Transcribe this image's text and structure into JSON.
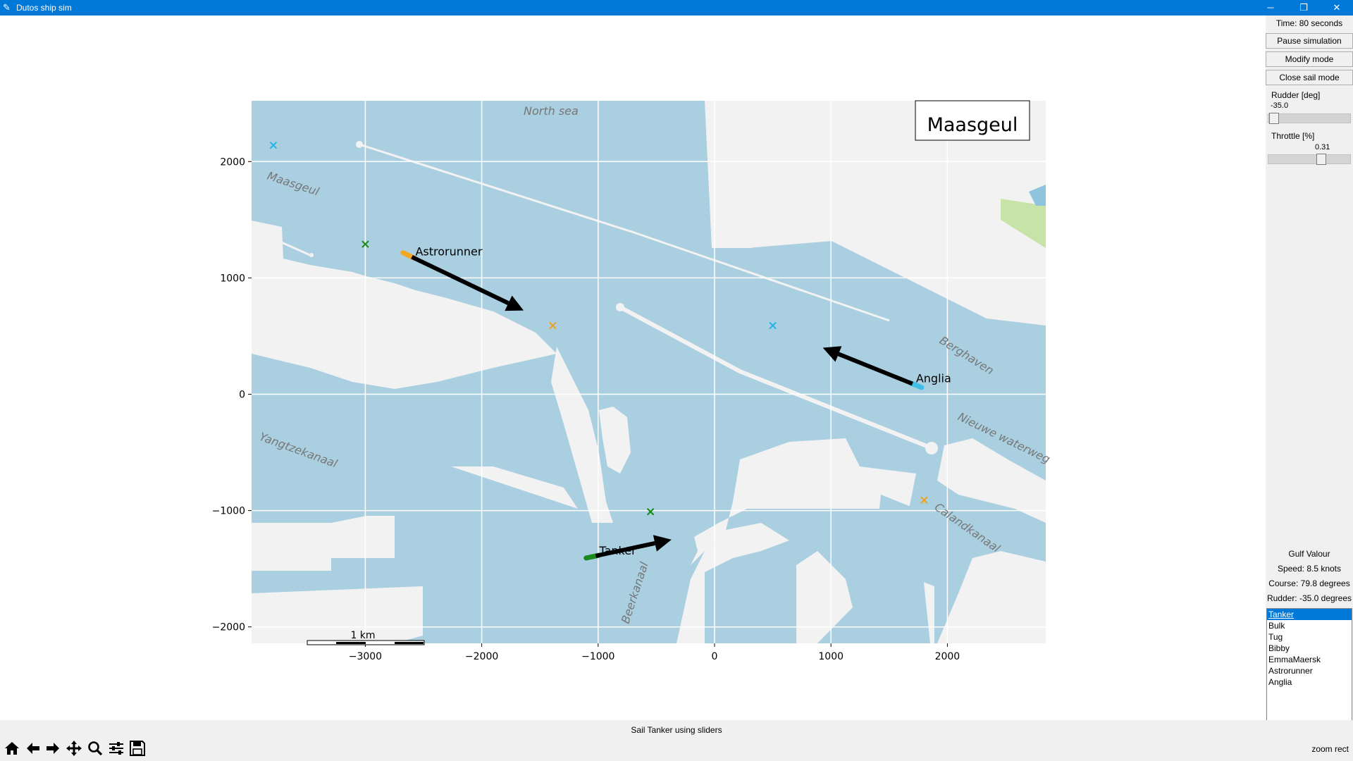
{
  "window": {
    "title": "Dutos ship sim",
    "minimize": "─",
    "restore": "❐",
    "close": "✕"
  },
  "sidebar": {
    "time": "Time: 80 seconds",
    "pause_label": "Pause simulation",
    "modify_label": "Modify mode",
    "close_sail_label": "Close sail mode",
    "rudder_label": "Rudder [deg]",
    "rudder_value": "-35.0",
    "rudder_position": 0.0,
    "throttle_label": "Throttle [%]",
    "throttle_value": "0.31",
    "throttle_position": 0.655,
    "ship_name": "Gulf Valour",
    "speed": "Speed: 8.5 knots",
    "course": "Course: 79.8 degrees",
    "rudder": "Rudder: -35.0 degrees",
    "ships": [
      "Tanker",
      "Bulk",
      "Tug",
      "Bibby",
      "EmmaMaersk",
      "Astrorunner",
      "Anglia"
    ],
    "selected_ship": "Tanker"
  },
  "map": {
    "title": "Maasgeul",
    "labels": [
      "North sea",
      "Maasgeul",
      "Yangtzekanaal",
      "Beerkanaal",
      "Calandkanaal",
      "Nieuwe waterweg",
      "Berghaven"
    ],
    "scale_bar": "1 km",
    "colors": {
      "water": "#aacfe0",
      "land": "#f2f2f2",
      "grid": "#ffffff"
    }
  },
  "chart_data": {
    "type": "scatter",
    "title": "Maasgeul",
    "xlim": [
      -3000,
      2000
    ],
    "ylim": [
      -2000,
      2000
    ],
    "xticks": [
      "−3000",
      "−2000",
      "−1000",
      "0",
      "1000",
      "2000"
    ],
    "yticks": [
      "2000",
      "1000",
      "0",
      "−1000",
      "−2000"
    ],
    "grid": true,
    "ships": [
      {
        "name": "Astrorunner",
        "x": -2600,
        "y": 1180,
        "color": "#f5a623"
      },
      {
        "name": "Anglia",
        "x": 1700,
        "y": 90,
        "color": "#3dbfe8"
      },
      {
        "name": "Tanker",
        "x": -1020,
        "y": -1390,
        "color": "#1a8a1a"
      }
    ],
    "waypoints": [
      {
        "x": -3790,
        "y": 2140,
        "color": "#22b5e6"
      },
      {
        "x": -3000,
        "y": 1290,
        "color": "#128a12"
      },
      {
        "x": -1390,
        "y": 590,
        "color": "#f0a020"
      },
      {
        "x": 500,
        "y": 590,
        "color": "#22b5e6"
      },
      {
        "x": -550,
        "y": -1010,
        "color": "#128a12"
      },
      {
        "x": 1800,
        "y": -910,
        "color": "#f0a020"
      }
    ]
  },
  "status": {
    "message": "Sail Tanker using sliders",
    "mode": "zoom rect"
  },
  "toolbar": [
    "home-icon",
    "back-icon",
    "forward-icon",
    "pan-icon",
    "zoom-icon",
    "configure-icon",
    "save-icon"
  ]
}
